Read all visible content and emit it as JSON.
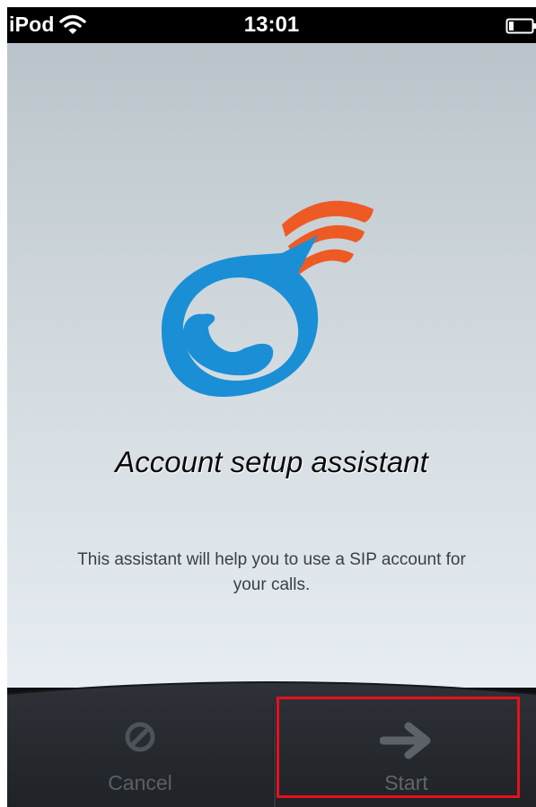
{
  "status_bar": {
    "carrier": "iPod",
    "time": "13:01",
    "wifi_icon": "wifi-icon",
    "battery_icon": "battery-icon"
  },
  "main": {
    "logo_icon": "phone-speech-bubble-icon",
    "title": "Account setup assistant",
    "description": "This assistant will help you to use a SIP account for your calls."
  },
  "toolbar": {
    "cancel_label": "Cancel",
    "cancel_icon": "prohibited-icon",
    "start_label": "Start",
    "start_icon": "arrow-right-icon"
  },
  "colors": {
    "logo_blue": "#1a8fd6",
    "signal_orange": "#ee5a24",
    "toolbar_bg": "#25292e",
    "highlight": "#e8101c"
  }
}
